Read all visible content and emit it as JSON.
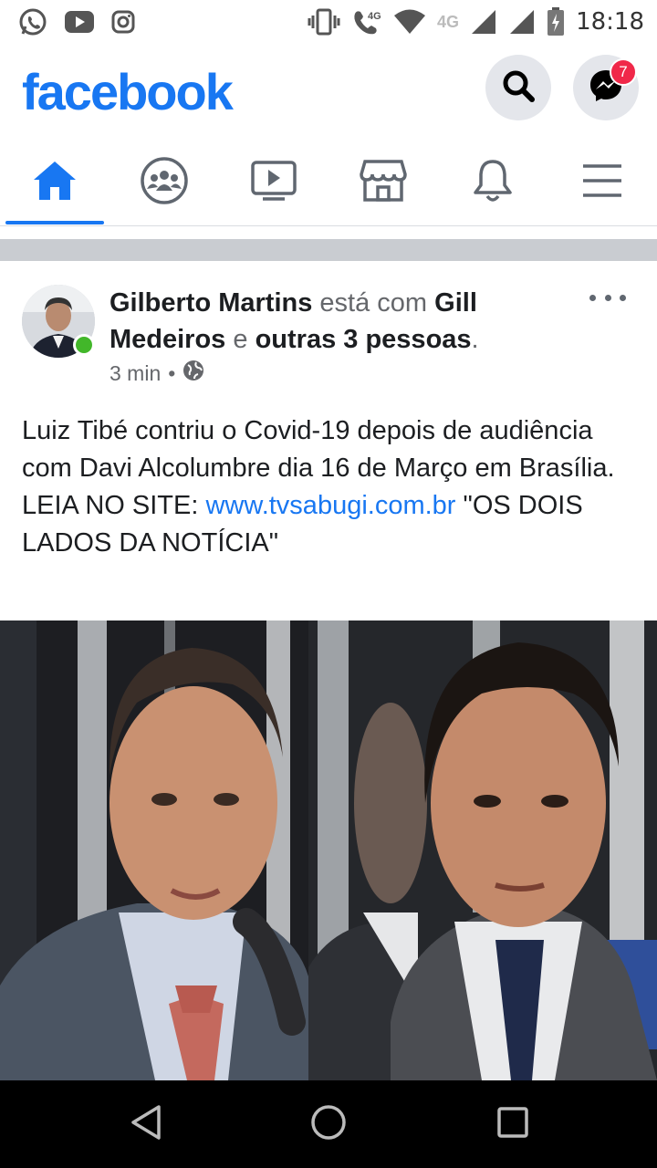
{
  "status_bar": {
    "time": "18:18",
    "network_label_1": "4G",
    "network_label_2": "4G",
    "icons": [
      "whatsapp-icon",
      "youtube-icon",
      "instagram-icon",
      "vibrate-icon",
      "volte-call-icon",
      "wifi-icon",
      "signal-icon",
      "battery-icon"
    ]
  },
  "header": {
    "logo": "facebook",
    "messenger_badge": "7",
    "colors": {
      "brand": "#1877f2",
      "badge": "#f02849"
    }
  },
  "tabs": [
    "home-icon",
    "groups-icon",
    "watch-icon",
    "marketplace-icon",
    "notifications-icon",
    "menu-icon"
  ],
  "post": {
    "author": "Gilberto Martins",
    "with_text": "está com",
    "tagged": "Gill Medeiros",
    "and_text": "e",
    "others": "outras 3 pessoas",
    "period": ".",
    "time": "3 min",
    "separator": "•",
    "audience_icon": "globe-icon",
    "text_line_1": "Luiz Tibé contriu o Covid-19 depois de audiência com Davi Alcolumbre dia 16 de Março em Brasília.",
    "text_read_prefix": "LEIA NO SITE: ",
    "link": "www.tvsabugi.com.br",
    "text_read_suffix": " \"OS DOIS LADOS DA NOTÍCIA\""
  },
  "navbar": [
    "back-icon",
    "home-circle-icon",
    "recents-icon"
  ]
}
